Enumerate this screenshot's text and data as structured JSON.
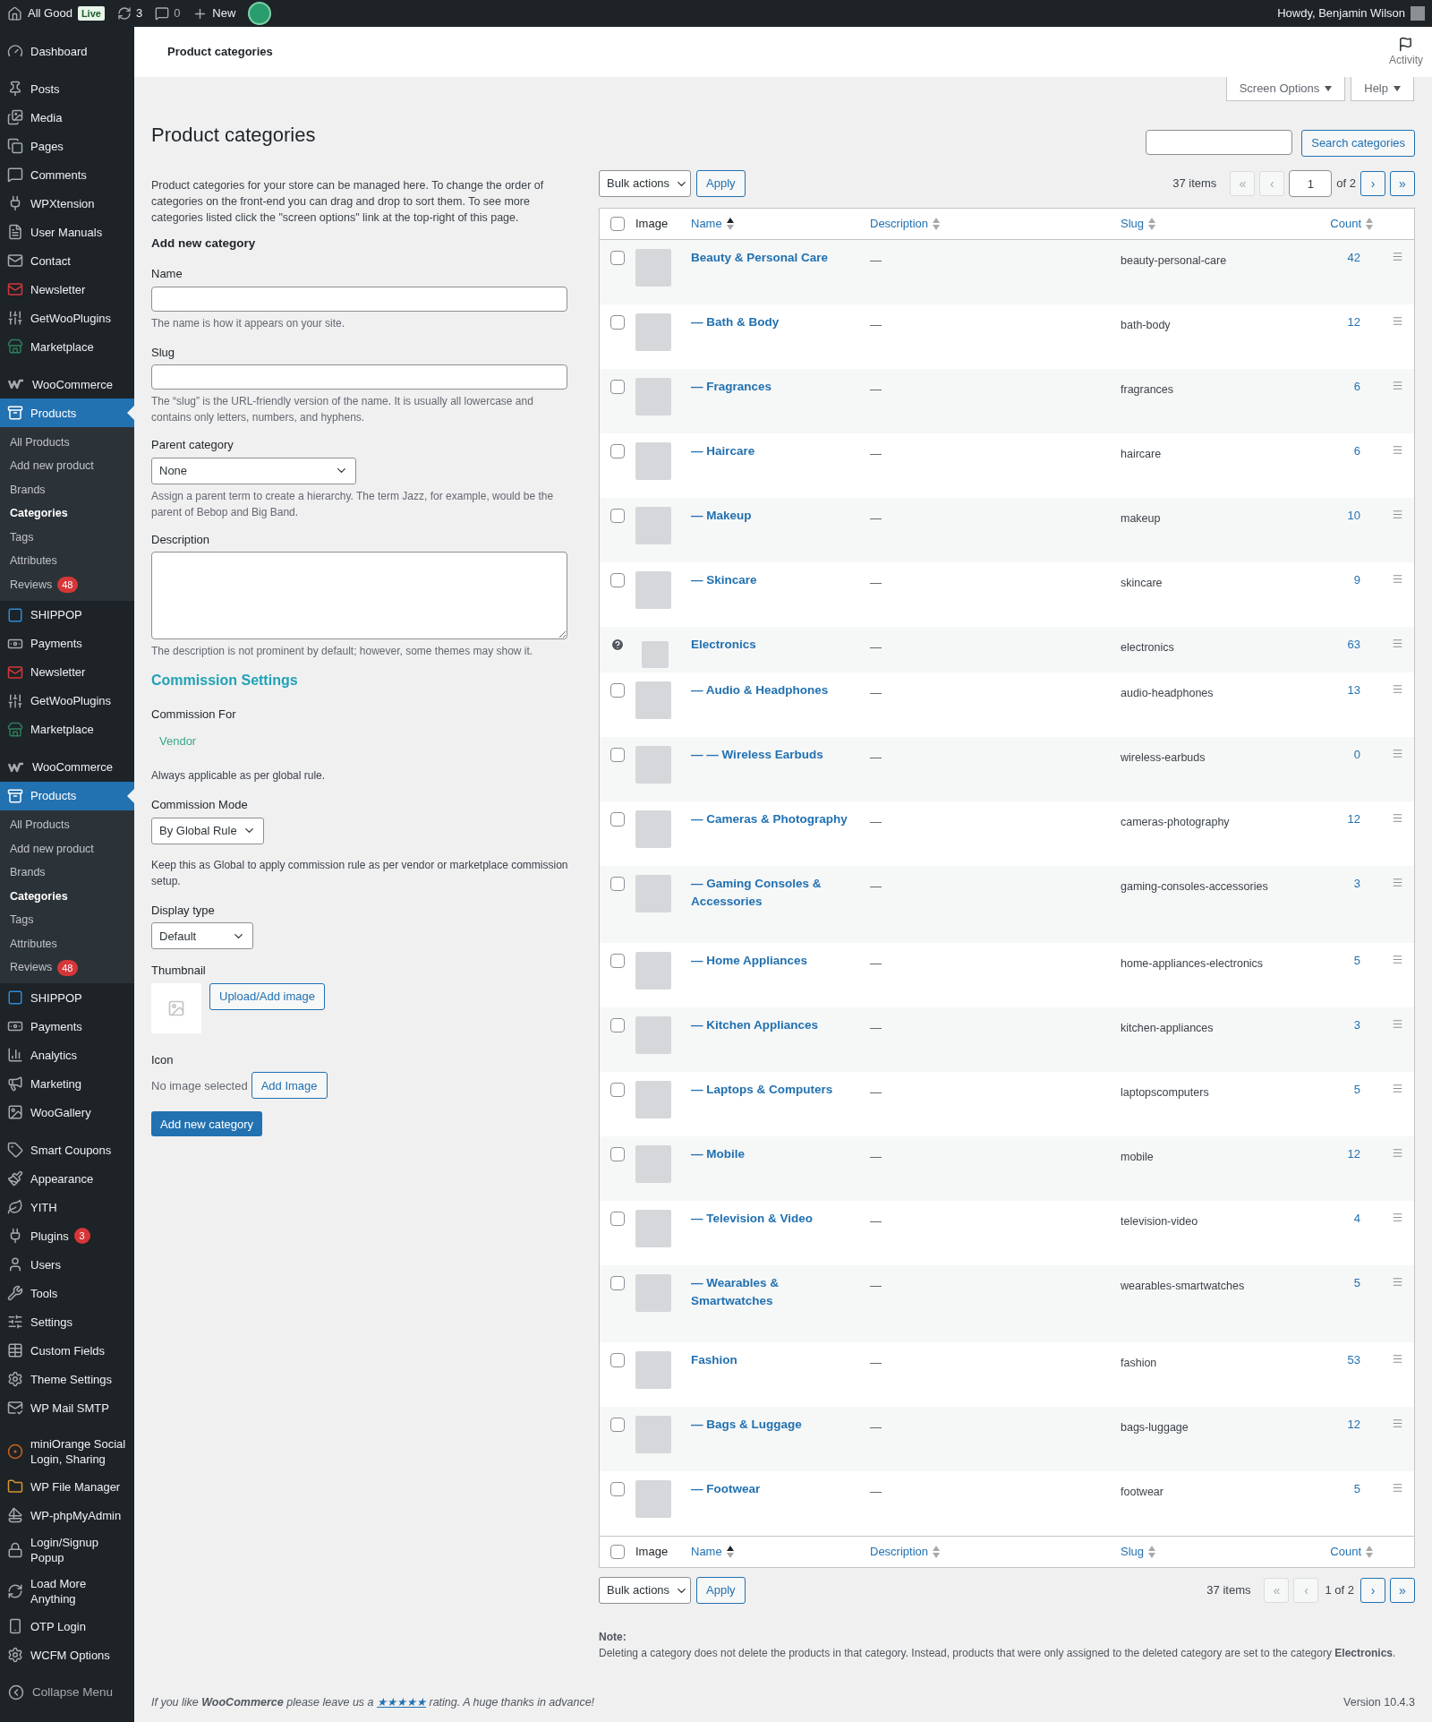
{
  "admin_bar": {
    "site": "All Good",
    "live_badge": "Live",
    "updates": "3",
    "comments": "0",
    "new": "New",
    "greeting": "Howdy, Benjamin Wilson"
  },
  "sidebar": {
    "groups": [
      [
        {
          "label": "Dashboard",
          "selected": false
        }
      ],
      [
        {
          "label": "Posts",
          "selected": false
        },
        {
          "label": "Media",
          "selected": false
        },
        {
          "label": "Pages",
          "selected": false
        },
        {
          "label": "Comments",
          "selected": false
        },
        {
          "label": "WPXtension",
          "selected": false
        },
        {
          "label": "User Manuals",
          "selected": false
        },
        {
          "label": "Contact",
          "selected": false
        },
        {
          "label": "Newsletter",
          "selected": false
        },
        {
          "label": "GetWooPlugins",
          "selected": false
        },
        {
          "label": "Marketplace",
          "selected": false
        }
      ],
      [
        {
          "label": "WooCommerce",
          "selected": false
        },
        {
          "label": "Products",
          "selected": true,
          "submenu": [
            {
              "label": "All Products",
              "selected": false
            },
            {
              "label": "Add new product",
              "selected": false
            },
            {
              "label": "Brands",
              "selected": false
            },
            {
              "label": "Categories",
              "selected": true
            },
            {
              "label": "Tags",
              "selected": false
            },
            {
              "label": "Attributes",
              "selected": false
            },
            {
              "label": "Reviews",
              "selected": false,
              "badge": "48"
            }
          ]
        },
        {
          "label": "SHIPPOP",
          "selected": false
        },
        {
          "label": "Payments",
          "selected": false
        },
        {
          "label": "Newsletter",
          "selected": false
        },
        {
          "label": "GetWooPlugins",
          "selected": false
        },
        {
          "label": "Marketplace",
          "selected": false
        }
      ],
      [
        {
          "label": "WooCommerce",
          "selected": false
        },
        {
          "label": "Products",
          "selected": true,
          "submenu": [
            {
              "label": "All Products",
              "selected": false
            },
            {
              "label": "Add new product",
              "selected": false
            },
            {
              "label": "Brands",
              "selected": false
            },
            {
              "label": "Categories",
              "selected": true
            },
            {
              "label": "Tags",
              "selected": false
            },
            {
              "label": "Attributes",
              "selected": false
            },
            {
              "label": "Reviews",
              "selected": false,
              "badge": "48"
            }
          ]
        },
        {
          "label": "SHIPPOP",
          "selected": false
        },
        {
          "label": "Payments",
          "selected": false
        },
        {
          "label": "Analytics",
          "selected": false
        },
        {
          "label": "Marketing",
          "selected": false
        },
        {
          "label": "WooGallery",
          "selected": false
        }
      ],
      [
        {
          "label": "Smart Coupons",
          "selected": false
        },
        {
          "label": "Appearance",
          "selected": false
        },
        {
          "label": "YITH",
          "selected": false
        },
        {
          "label": "Plugins",
          "selected": false,
          "badge": "3"
        },
        {
          "label": "Users",
          "selected": false
        },
        {
          "label": "Tools",
          "selected": false
        },
        {
          "label": "Settings",
          "selected": false
        },
        {
          "label": "Custom Fields",
          "selected": false
        },
        {
          "label": "Theme Settings",
          "selected": false
        },
        {
          "label": "WP Mail SMTP",
          "selected": false
        }
      ],
      [
        {
          "label": "miniOrange Social Login, Sharing",
          "selected": false
        },
        {
          "label": "WP File Manager",
          "selected": false
        },
        {
          "label": "WP-phpMyAdmin",
          "selected": false
        },
        {
          "label": "Login/Signup Popup",
          "selected": false
        },
        {
          "label": "Load More Anything",
          "selected": false
        },
        {
          "label": "OTP Login",
          "selected": false
        },
        {
          "label": "WCFM Options",
          "selected": false
        }
      ]
    ],
    "collapse": "Collapse Menu"
  },
  "header": {
    "title": "Product categories",
    "activity": "Activity",
    "screen_options": "Screen Options",
    "help": "Help"
  },
  "page_title": "Product categories",
  "form": {
    "intro": "Product categories for your store can be managed here. To change the order of categories on the front-end you can drag and drop to sort them. To see more categories listed click the \"screen options\" link at the top-right of this page.",
    "heading": "Add new category",
    "name_label": "Name",
    "name_hint": "The name is how it appears on your site.",
    "slug_label": "Slug",
    "slug_hint": "The “slug” is the URL-friendly version of the name. It is usually all lowercase and contains only letters, numbers, and hyphens.",
    "parent_label": "Parent category",
    "parent_value": "None",
    "parent_hint": "Assign a parent term to create a hierarchy. The term Jazz, for example, would be the parent of Bebop and Big Band.",
    "description_label": "Description",
    "description_hint": "The description is not prominent by default; however, some themes may show it.",
    "commission_heading": "Commission Settings",
    "commission_for_label": "Commission For",
    "commission_for_value": "Vendor",
    "commission_for_hint": "Always applicable as per global rule.",
    "commission_mode_label": "Commission Mode",
    "commission_mode_value": "By Global Rule",
    "commission_mode_hint": "Keep this as Global to apply commission rule as per vendor or marketplace commission setup.",
    "display_type_label": "Display type",
    "display_type_value": "Default",
    "thumbnail_label": "Thumbnail",
    "upload_button": "Upload/Add image",
    "icon_label": "Icon",
    "icon_status": "No image selected",
    "add_image_button": "Add Image",
    "submit": "Add new category"
  },
  "search": {
    "button": "Search categories"
  },
  "tablenav_top": {
    "bulk": "Bulk actions",
    "apply": "Apply",
    "items": "37 items",
    "first": "«",
    "prev": "‹",
    "page": "1",
    "of": "of 2",
    "next": "›",
    "last": "»",
    "first_disabled": true,
    "prev_disabled": true
  },
  "table": {
    "select_all": {
      "checked": false
    },
    "footer_select_all": {
      "checked": false
    },
    "columns": [
      {
        "label": "Image",
        "sortable": false
      },
      {
        "label": "Name",
        "sortable": true,
        "sorted": true
      },
      {
        "label": "Description",
        "sortable": true,
        "sorted": false
      },
      {
        "label": "Slug",
        "sortable": true,
        "sorted": false
      },
      {
        "label": "Count",
        "sortable": true,
        "sorted": false
      }
    ],
    "rows": [
      {
        "kind": "category",
        "checked": false,
        "name": "Beauty & Personal Care",
        "description": "—",
        "slug": "beauty-personal-care",
        "count": "42"
      },
      {
        "kind": "category",
        "checked": false,
        "name": "— Bath & Body",
        "description": "—",
        "slug": "bath-body",
        "count": "12"
      },
      {
        "kind": "category",
        "checked": false,
        "name": "— Fragrances",
        "description": "—",
        "slug": "fragrances",
        "count": "6"
      },
      {
        "kind": "category",
        "checked": false,
        "name": "— Haircare",
        "description": "—",
        "slug": "haircare",
        "count": "6"
      },
      {
        "kind": "category",
        "checked": false,
        "name": "— Makeup",
        "description": "—",
        "slug": "makeup",
        "count": "10"
      },
      {
        "kind": "category",
        "checked": false,
        "name": "— Skincare",
        "description": "—",
        "slug": "skincare",
        "count": "9"
      },
      {
        "kind": "default",
        "name": "Electronics",
        "description": "—",
        "slug": "electronics",
        "count": "63"
      },
      {
        "kind": "category",
        "checked": false,
        "name": "— Audio & Headphones",
        "description": "—",
        "slug": "audio-headphones",
        "count": "13"
      },
      {
        "kind": "category",
        "checked": false,
        "name": "— — Wireless Earbuds",
        "description": "—",
        "slug": "wireless-earbuds",
        "count": "0"
      },
      {
        "kind": "category",
        "checked": false,
        "name": "— Cameras & Photography",
        "description": "—",
        "slug": "cameras-photography",
        "count": "12"
      },
      {
        "kind": "category",
        "checked": false,
        "name": "— Gaming Consoles & Accessories",
        "description": "—",
        "slug": "gaming-consoles-accessories",
        "count": "3"
      },
      {
        "kind": "category",
        "checked": false,
        "name": "— Home Appliances",
        "description": "—",
        "slug": "home-appliances-electronics",
        "count": "5"
      },
      {
        "kind": "category",
        "checked": false,
        "name": "— Kitchen Appliances",
        "description": "—",
        "slug": "kitchen-appliances",
        "count": "3"
      },
      {
        "kind": "category",
        "checked": false,
        "name": "— Laptops & Computers",
        "description": "—",
        "slug": "laptopscomputers",
        "count": "5"
      },
      {
        "kind": "category",
        "checked": false,
        "name": "— Mobile",
        "description": "—",
        "slug": "mobile",
        "count": "12"
      },
      {
        "kind": "category",
        "checked": false,
        "name": "— Television & Video",
        "description": "—",
        "slug": "television-video",
        "count": "4"
      },
      {
        "kind": "category",
        "checked": false,
        "name": "— Wearables & Smartwatches",
        "description": "—",
        "slug": "wearables-smartwatches",
        "count": "5"
      },
      {
        "kind": "category",
        "checked": false,
        "name": "Fashion",
        "description": "—",
        "slug": "fashion",
        "count": "53"
      },
      {
        "kind": "category",
        "checked": false,
        "name": "— Bags & Luggage",
        "description": "—",
        "slug": "bags-luggage",
        "count": "12"
      },
      {
        "kind": "category",
        "checked": false,
        "name": "— Footwear",
        "description": "—",
        "slug": "footwear",
        "count": "5"
      }
    ],
    "footer_columns": [
      {
        "label": "Image",
        "sortable": false
      },
      {
        "label": "Name",
        "sortable": true,
        "sorted": true
      },
      {
        "label": "Description",
        "sortable": true,
        "sorted": false
      },
      {
        "label": "Slug",
        "sortable": true,
        "sorted": false
      },
      {
        "label": "Count",
        "sortable": true,
        "sorted": false
      }
    ]
  },
  "tablenav_bottom": {
    "bulk": "Bulk actions",
    "apply": "Apply",
    "items": "37 items",
    "first": "«",
    "prev": "‹",
    "pages": "1 of 2",
    "next": "›",
    "last": "»",
    "first_disabled": true,
    "prev_disabled": true
  },
  "note": {
    "title": "Note:",
    "text": "Deleting a category does not delete the products in that category. Instead, products that were only assigned to the deleted category are set to the category **Electronics**."
  },
  "footer": {
    "before": "If you like **WooCommerce** please leave us a",
    "stars": "★★★★★",
    "after": "rating. A huge thanks in advance!",
    "version": "Version 10.4.3"
  }
}
